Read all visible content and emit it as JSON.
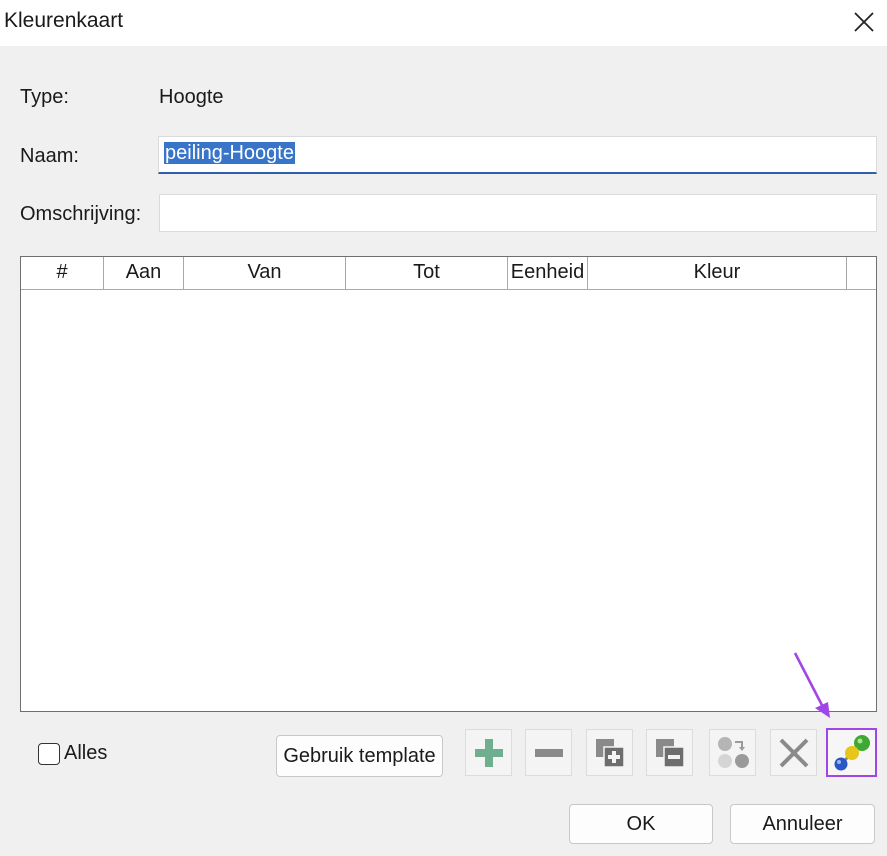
{
  "window": {
    "title": "Kleurenkaart"
  },
  "form": {
    "type_label": "Type:",
    "type_value": "Hoogte",
    "name_label": "Naam:",
    "name_value": "peiling-Hoogte",
    "description_label": "Omschrijving:",
    "description_value": ""
  },
  "table": {
    "columns": [
      "#",
      "Aan",
      "Van",
      "Tot",
      "Eenheid",
      "Kleur"
    ],
    "rows": []
  },
  "footer": {
    "all_label": "Alles",
    "all_checked": false,
    "template_button": "Gebruik template",
    "ok_button": "OK",
    "cancel_button": "Annuleer"
  },
  "toolbar": {
    "icons": [
      "plus-icon",
      "minus-icon",
      "add-copy-icon",
      "remove-copy-icon",
      "shift-dots-icon",
      "delete-x-icon",
      "link-icon"
    ],
    "active_icon": "link-icon"
  },
  "colors": {
    "accent_focus": "#2f5fae",
    "selection": "#3874c7",
    "highlight": "#a146e6",
    "plus_green": "#6fae8f",
    "link_green": "#3fa832",
    "link_yellow": "#e8c619",
    "link_blue": "#2b56c6"
  }
}
